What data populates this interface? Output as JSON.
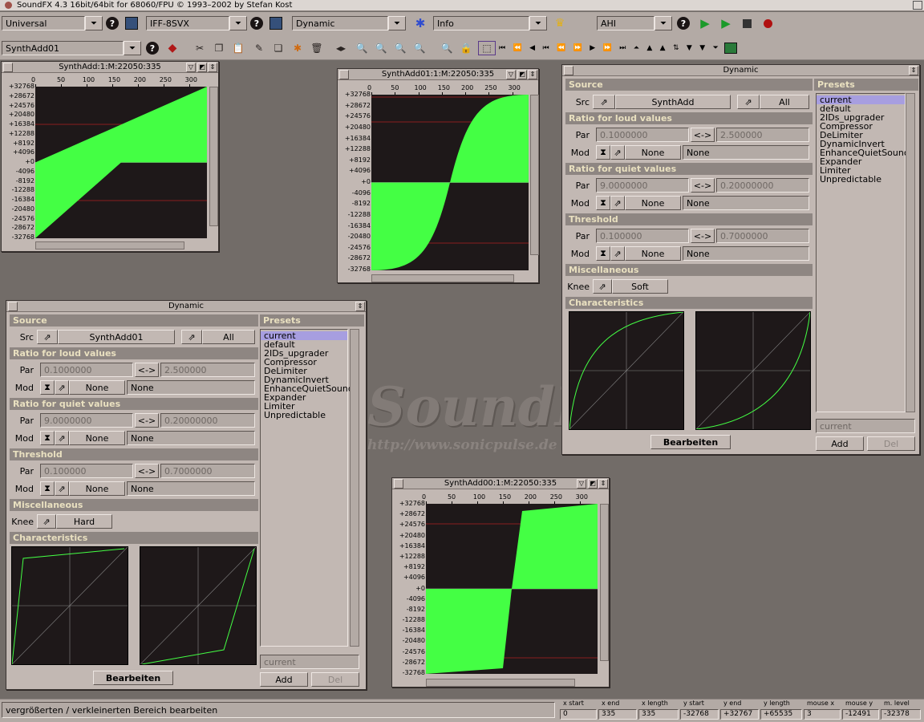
{
  "app": {
    "title": "SoundFX  4.3 16bit/64bit for 68060/FPU © 1993–2002 by Stefan Kost"
  },
  "toolbar": {
    "universal": "Universal",
    "format": "IFF-8SVX",
    "effect": "Dynamic",
    "info": "Info",
    "driver": "AHI",
    "buffer": "SynthAdd01",
    "help_label": "?"
  },
  "watermark": {
    "logo": "SoundFX",
    "url": "http://www.sonicpulse.de"
  },
  "waves": [
    {
      "title": "SynthAdd:1:M:22050:335"
    },
    {
      "title": "SynthAdd01:1:M:22050:335"
    },
    {
      "title": "SynthAdd00:1:M:22050:335"
    }
  ],
  "x_ticks": [
    "0",
    "50",
    "100",
    "150",
    "200",
    "250",
    "300"
  ],
  "y_ticks": [
    "+32768",
    "+28672",
    "+24576",
    "+20480",
    "+16384",
    "+12288",
    "+8192",
    "+4096",
    "+0",
    "-4096",
    "-8192",
    "-12288",
    "-16384",
    "-20480",
    "-24576",
    "-28672",
    "-32768"
  ],
  "dyn": {
    "title": "Dynamic",
    "source_label": "Source",
    "src_label": "Src",
    "src_all": "All",
    "loud_label": "Ratio for loud values",
    "quiet_label": "Ratio for quiet values",
    "threshold_label": "Threshold",
    "misc_label": "Miscellaneous",
    "charac_label": "Characteristics",
    "par_label": "Par",
    "mod_label": "Mod",
    "knee_label": "Knee",
    "swap_label": "<->",
    "none": "None",
    "loud_par1": "0.1000000",
    "loud_par2": "2.500000",
    "quiet_par1": "9.0000000",
    "quiet_par2": "0.20000000",
    "thr_par1": "0.100000",
    "thr_par2": "0.7000000",
    "edit_button": "Bearbeiten",
    "presets_label": "Presets",
    "presets": [
      "current",
      "default",
      "2IDs_upgrader",
      "Compressor",
      "DeLimiter",
      "DynamicInvert",
      "EnhanceQuietSounds",
      "Expander",
      "Limiter",
      "Unpredictable"
    ],
    "preset_name": "current",
    "add": "Add",
    "del": "Del"
  },
  "dyn_right": {
    "src": "SynthAdd",
    "knee": "Soft"
  },
  "dyn_left": {
    "src": "SynthAdd01",
    "knee": "Hard"
  },
  "status": {
    "message": "vergrößerten / verkleinerten Bereich bearbeiten",
    "fields": [
      {
        "label": "x start",
        "value": "0"
      },
      {
        "label": "x end",
        "value": "335"
      },
      {
        "label": "x length",
        "value": "335"
      },
      {
        "label": "y start",
        "value": "-32768"
      },
      {
        "label": "y end",
        "value": "+32767"
      },
      {
        "label": "y length",
        "value": "+65535"
      },
      {
        "label": "mouse x",
        "value": "3"
      },
      {
        "label": "mouse y",
        "value": "-12491"
      },
      {
        "label": "m. level",
        "value": "-32378"
      }
    ]
  },
  "colors": {
    "wave_fill": "#44ff44",
    "wave_bg": "#1e1819",
    "section_text": "#e9e0c0",
    "selection": "#a79ee0"
  }
}
